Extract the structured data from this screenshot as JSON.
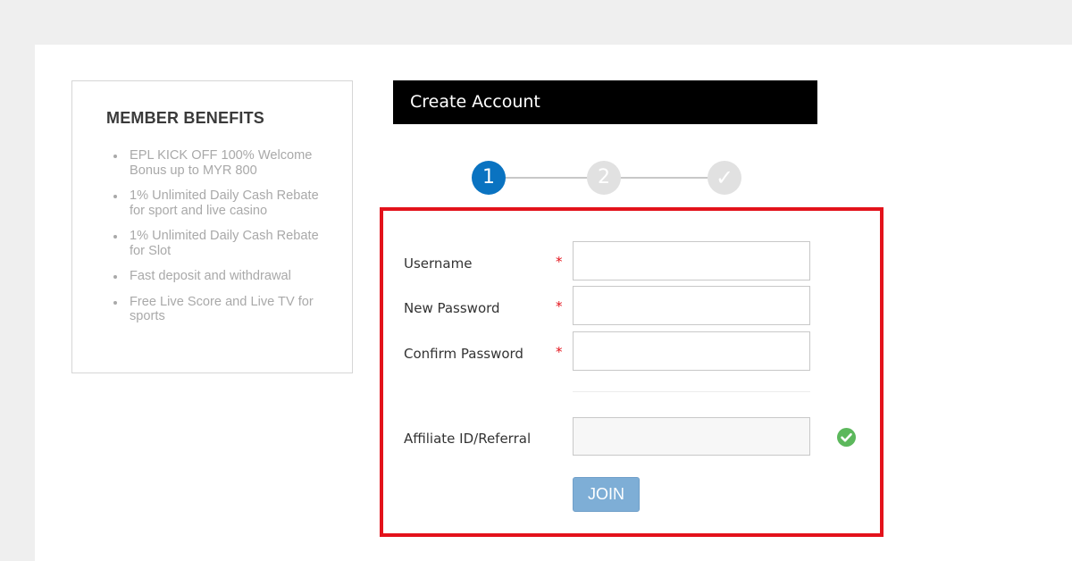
{
  "benefits": {
    "title": "MEMBER BENEFITS",
    "items": [
      "EPL KICK OFF 100% Welcome Bonus up to MYR 800",
      "1% Unlimited Daily Cash Rebate for sport and live casino",
      "1% Unlimited Daily Cash Rebate for Slot",
      "Fast deposit and withdrawal",
      "Free Live Score and Live TV for sports"
    ]
  },
  "header": {
    "title": "Create Account"
  },
  "stepper": {
    "steps": [
      "1",
      "2",
      "✓"
    ],
    "active_step": 1
  },
  "form": {
    "username_label": "Username",
    "new_password_label": "New Password",
    "confirm_password_label": "Confirm Password",
    "affiliate_label": "Affiliate ID/Referral",
    "required_mark": "*",
    "username_value": "",
    "new_password_value": "",
    "confirm_password_value": "",
    "affiliate_value": "",
    "join_label": "JOIN"
  },
  "icons": {
    "affiliate_status": "check-circle-icon"
  },
  "colors": {
    "accent_blue": "#0a73c1",
    "join_button": "#7eaed6",
    "highlight_red": "#e3121b",
    "success_green": "#5cb85c"
  }
}
